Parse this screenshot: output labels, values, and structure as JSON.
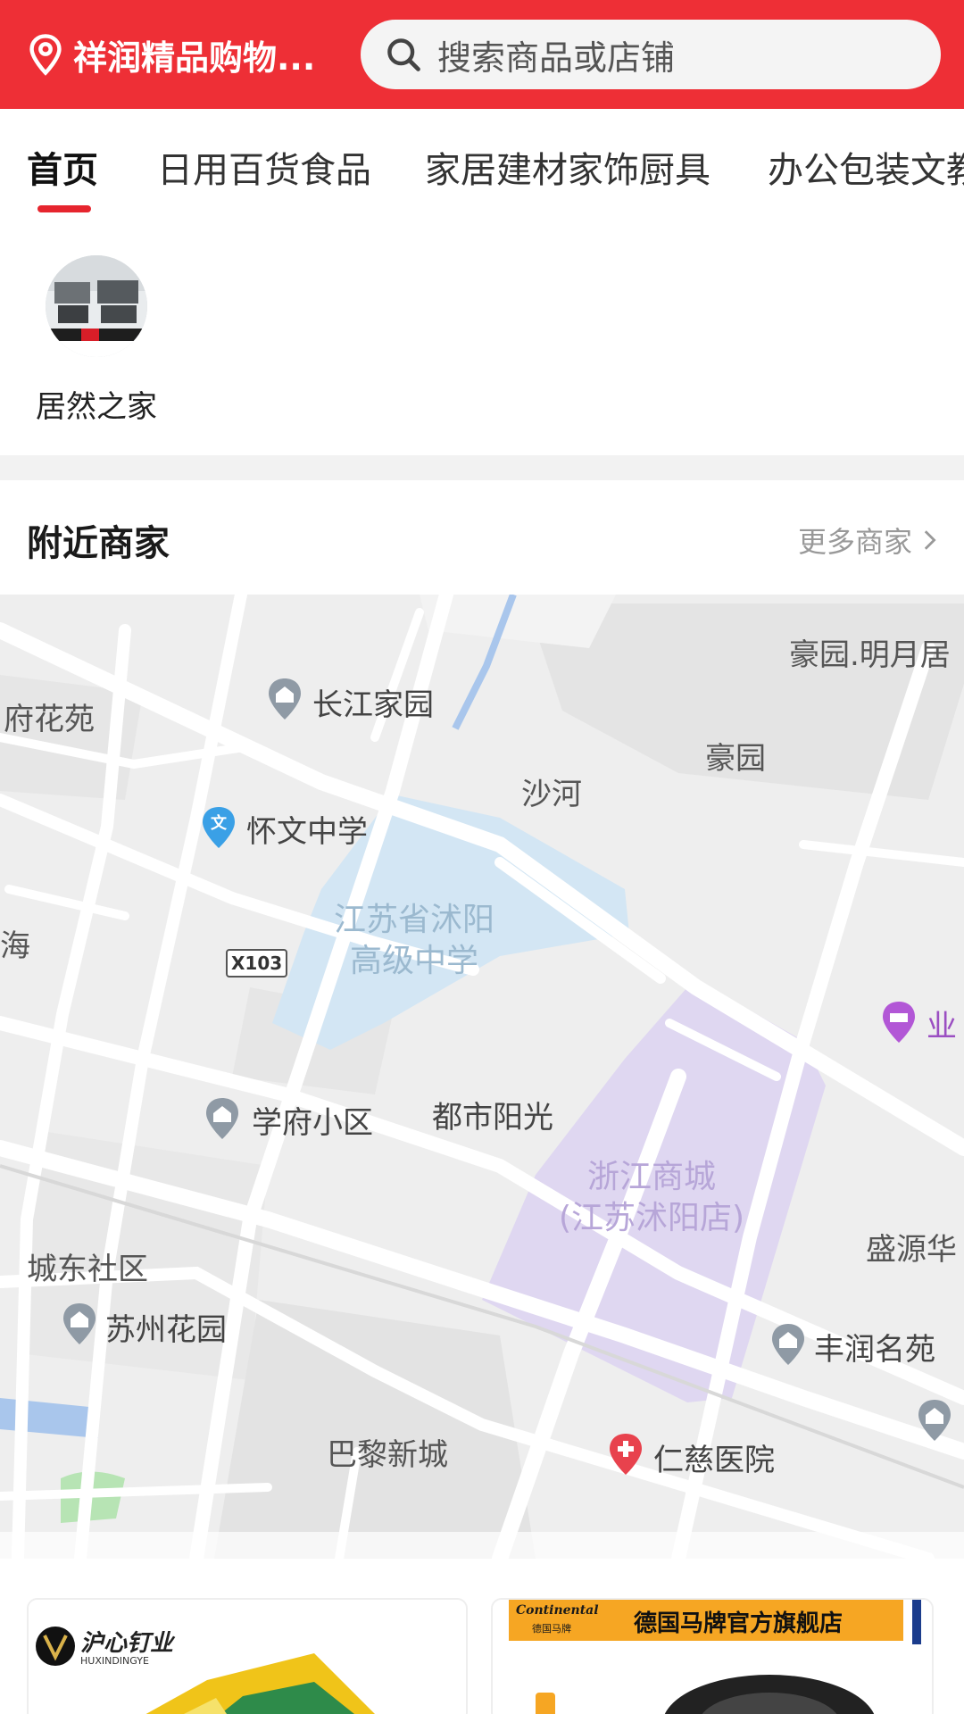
{
  "header": {
    "location": "祥润精品购物...",
    "search_placeholder": "搜索商品或店铺",
    "icons": {
      "location": "location-pin-icon",
      "search": "search-icon"
    },
    "color": "#ee2f36"
  },
  "tabs": [
    {
      "label": "首页",
      "active": true
    },
    {
      "label": "日用百货食品",
      "active": false
    },
    {
      "label": "家居建材家饰厨具",
      "active": false
    },
    {
      "label": "办公包装文教",
      "active": false
    }
  ],
  "brands": [
    {
      "label": "居然之家"
    }
  ],
  "nearby": {
    "title": "附近商家",
    "more": "更多商家"
  },
  "map": {
    "labels": {
      "haoyuan_mingyueju": "豪园.明月居",
      "fuhuayuan": "府花苑",
      "changjiang": "长江家园",
      "haoyuan": "豪园",
      "shahe": "沙河",
      "huaiwen": "怀文中学",
      "school": "江苏省沭阳\n高级中学",
      "x103": "X103",
      "hai": "海",
      "ye": "业",
      "xuefu": "学府小区",
      "dushi": "都市阳光",
      "zhejiang": "浙江商城\n(江苏沭阳店)",
      "chengdong": "城东社区",
      "shengyuan": "盛源华",
      "suzhou": "苏州花园",
      "fengrun": "丰润名苑",
      "bali": "巴黎新城",
      "renci": "仁慈医院"
    }
  },
  "cards": [
    {
      "brand_text": "沪心钉业",
      "brand_sub": "HUXINDINGYE"
    },
    {
      "brand_text": "德国马牌官方旗舰店",
      "logo_text": "Continental",
      "logo_sub": "德国马牌"
    }
  ]
}
